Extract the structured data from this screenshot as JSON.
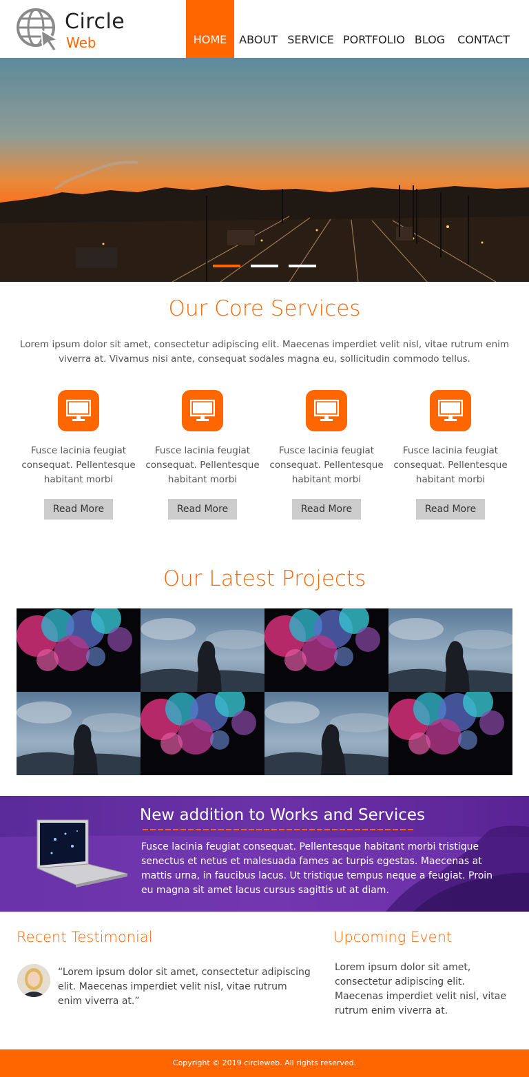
{
  "brand": {
    "name_line1": "Circle",
    "name_line2": "Web"
  },
  "nav": {
    "items": [
      {
        "label": "HOME",
        "active": true
      },
      {
        "label": "ABOUT"
      },
      {
        "label": "SERVICE"
      },
      {
        "label": "PORTFOLIO"
      },
      {
        "label": "BLOG"
      },
      {
        "label": "CONTACT"
      }
    ]
  },
  "hero": {
    "slides": 3,
    "active_slide": 1
  },
  "services": {
    "title": "Our Core Services",
    "intro": "Lorem ipsum dolor sit amet, consectetur adipiscing elit. Maecenas imperdiet velit nisl, vitae rutrum enim viverra at. Vivamus nisi ante, consequat sodales magna eu, sollicitudin commodo tellus.",
    "items": [
      {
        "icon": "monitor-icon",
        "text": "Fusce lacinia feugiat consequat. Pellentesque habitant morbi tristique…",
        "button": "Read More"
      },
      {
        "icon": "monitor-icon",
        "text": "Fusce lacinia feugiat consequat. Pellentesque habitant morbi tristique…",
        "button": "Read More"
      },
      {
        "icon": "monitor-icon",
        "text": "Fusce lacinia feugiat consequat. Pellentesque habitant morbi tristique…",
        "button": "Read More"
      },
      {
        "icon": "monitor-icon",
        "text": "Fusce lacinia feugiat consequat. Pellentesque habitant morbi tristique…",
        "button": "Read More"
      }
    ]
  },
  "projects": {
    "title": "Our Latest Projects",
    "tiles": [
      "smoke",
      "statue",
      "smoke",
      "statue",
      "statue",
      "smoke",
      "statue",
      "smoke"
    ]
  },
  "banner": {
    "title": "New addition to Works and Services",
    "text": "Fusce lacinia feugiat consequat. Pellentesque habitant morbi tristique senectus et netus et malesuada fames ac turpis egestas. Maecenas at mattis urna, in faucibus lacus. Ut tristique tempus neque a feugiat. Proin eu magna sit amet lacus cursus sagittis ut at diam."
  },
  "testimonial": {
    "title": "Recent Testimonial",
    "quote": "“Lorem ipsum dolor sit amet, consectetur adipiscing elit. Maecenas imperdiet velit nisl, vitae rutrum enim viverra at.”"
  },
  "event": {
    "title": "Upcoming Event",
    "text": "Lorem ipsum dolor sit amet, consectetur adipiscing elit. Maecenas imperdiet velit nisl, vitae rutrum enim viverra at."
  },
  "footer": {
    "copyright": "Copyright © 2019 circleweb. All rights reserved."
  },
  "colors": {
    "accent": "#ff6600",
    "banner": "#6b32a8",
    "button": "#cccccc"
  }
}
